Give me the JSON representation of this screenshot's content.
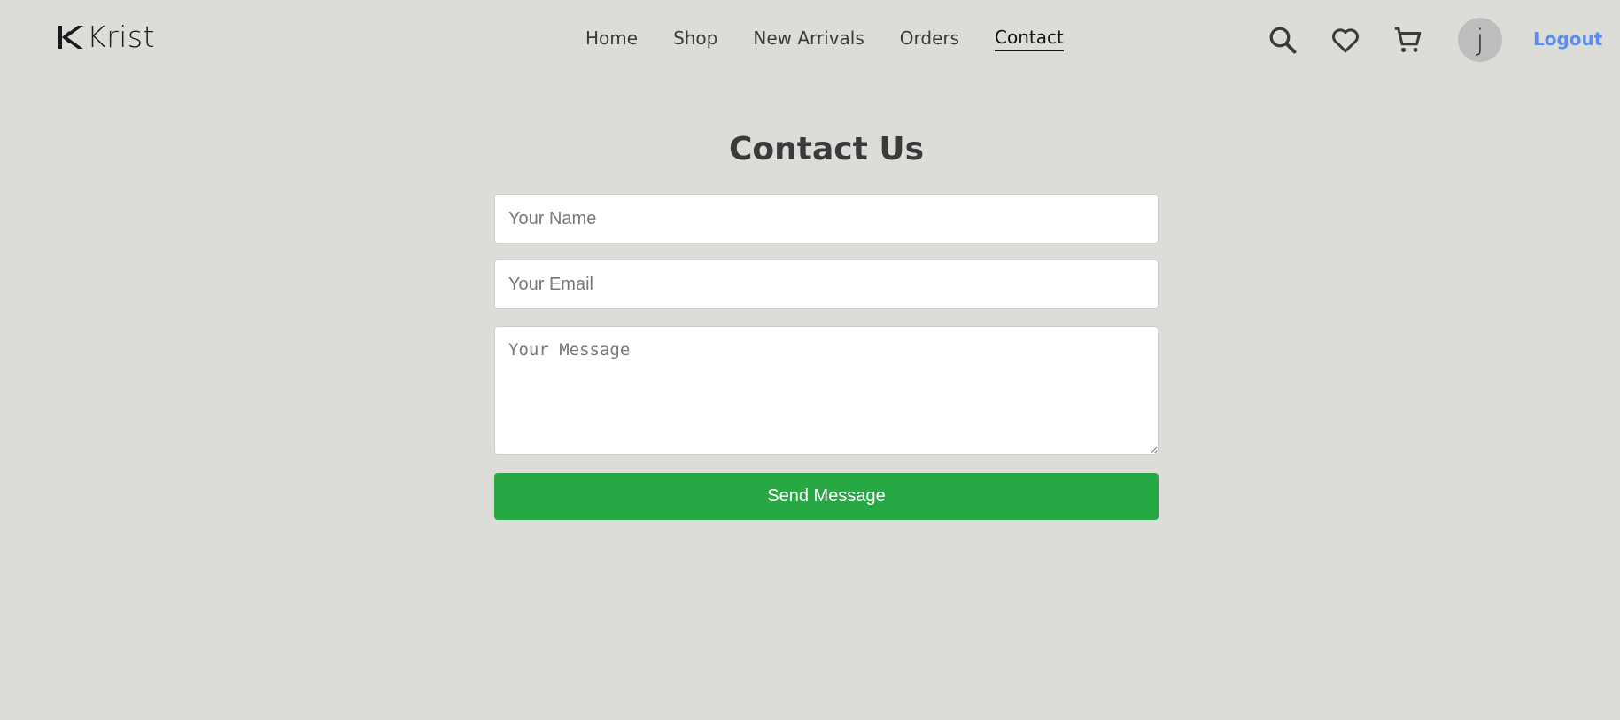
{
  "brand": {
    "name": "Krist"
  },
  "nav": {
    "links": [
      {
        "label": "Home"
      },
      {
        "label": "Shop"
      },
      {
        "label": "New Arrivals"
      },
      {
        "label": "Orders"
      },
      {
        "label": "Contact",
        "active": true
      }
    ]
  },
  "header_icons": {
    "search": "search-icon",
    "wishlist": "heart-icon",
    "cart": "cart-icon"
  },
  "user": {
    "avatar_initial": "j",
    "logout_label": "Logout"
  },
  "contact": {
    "title": "Contact Us",
    "name_placeholder": "Your Name",
    "email_placeholder": "Your Email",
    "message_placeholder": "Your Message",
    "submit_label": "Send Message"
  },
  "colors": {
    "background": "#dcdcd8",
    "accent": "#28a745",
    "link": "#5b8def"
  }
}
